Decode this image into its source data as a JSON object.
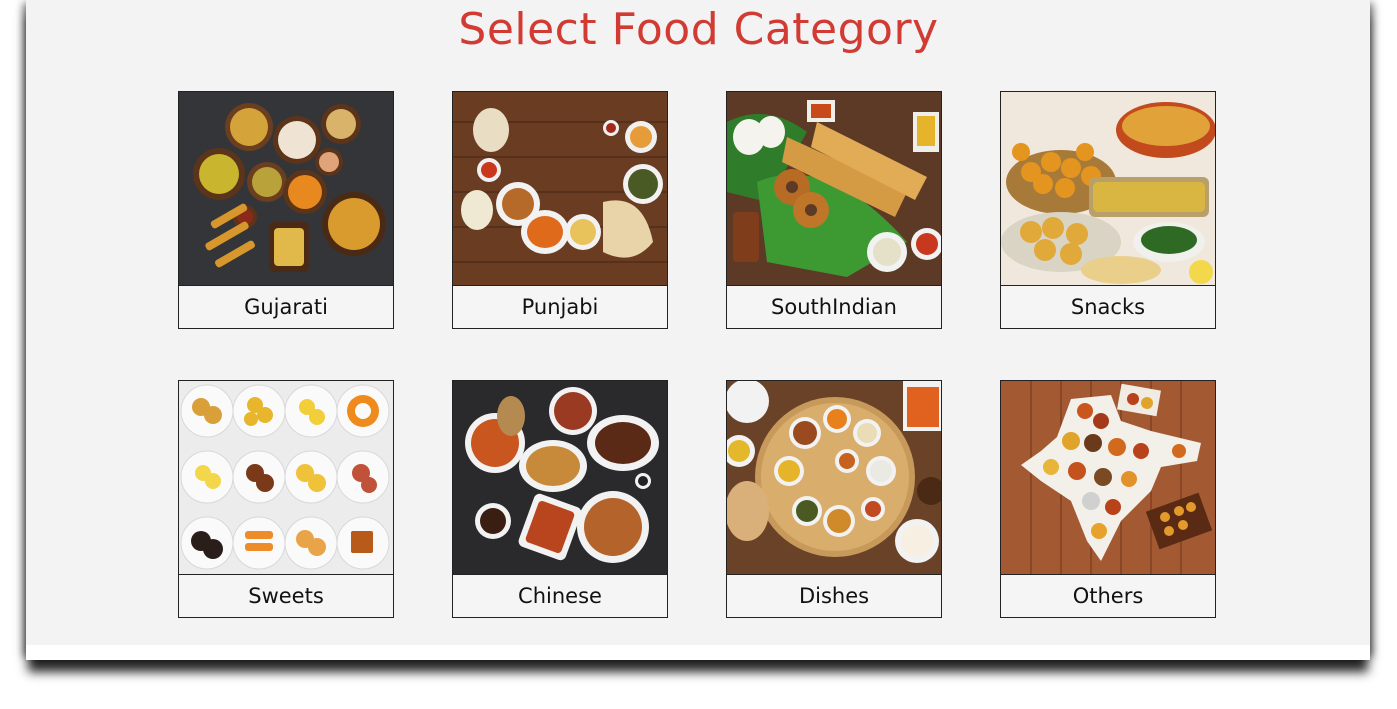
{
  "page": {
    "title": "Select Food Category"
  },
  "colors": {
    "title": "#d23b33",
    "background": "#f3f3f3"
  },
  "categories": [
    {
      "label": "Gujarati",
      "image_desc": "gujarati-thali-image"
    },
    {
      "label": "Punjabi",
      "image_desc": "punjabi-dishes-image"
    },
    {
      "label": "SouthIndian",
      "image_desc": "dosa-vada-image"
    },
    {
      "label": "Snacks",
      "image_desc": "snacks-platter-image"
    },
    {
      "label": "Sweets",
      "image_desc": "indian-sweets-image"
    },
    {
      "label": "Chinese",
      "image_desc": "chinese-dishes-image"
    },
    {
      "label": "Dishes",
      "image_desc": "thali-dishes-image"
    },
    {
      "label": "Others",
      "image_desc": "india-map-food-image"
    }
  ]
}
